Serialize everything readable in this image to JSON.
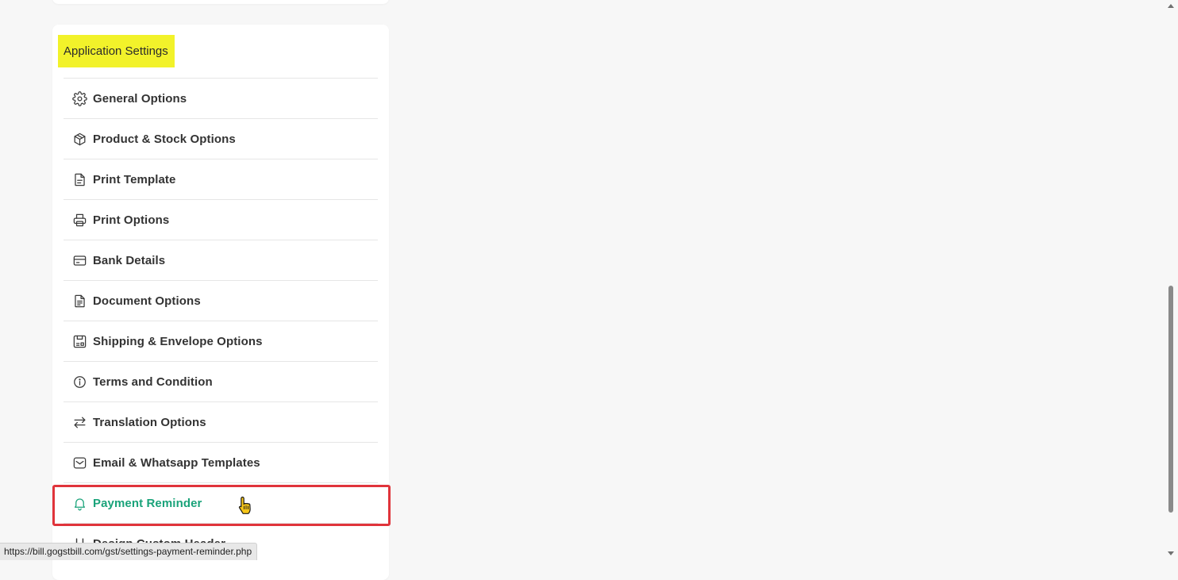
{
  "section": {
    "title": "Application Settings"
  },
  "menu": {
    "items": [
      {
        "label": "General Options",
        "icon": "gear-icon"
      },
      {
        "label": "Product & Stock Options",
        "icon": "box-icon"
      },
      {
        "label": "Print Template",
        "icon": "document-template-icon"
      },
      {
        "label": "Print Options",
        "icon": "printer-icon"
      },
      {
        "label": "Bank Details",
        "icon": "credit-card-icon"
      },
      {
        "label": "Document Options",
        "icon": "document-icon"
      },
      {
        "label": "Shipping & Envelope Options",
        "icon": "shipping-label-icon"
      },
      {
        "label": "Terms and Condition",
        "icon": "info-icon"
      },
      {
        "label": "Translation Options",
        "icon": "swap-arrows-icon"
      },
      {
        "label": "Email & Whatsapp Templates",
        "icon": "envelope-icon"
      },
      {
        "label": "Payment Reminder",
        "icon": "bell-icon",
        "active": true
      },
      {
        "label": "Design Custom Header",
        "icon": "header-icon"
      }
    ]
  },
  "status_bar": {
    "url": "https://bill.gogstbill.com/gst/settings-payment-reminder.php"
  },
  "colors": {
    "highlight_title_bg": "#f2f22a",
    "active_item": "#1aa37a",
    "selection_border": "#e0343b"
  }
}
